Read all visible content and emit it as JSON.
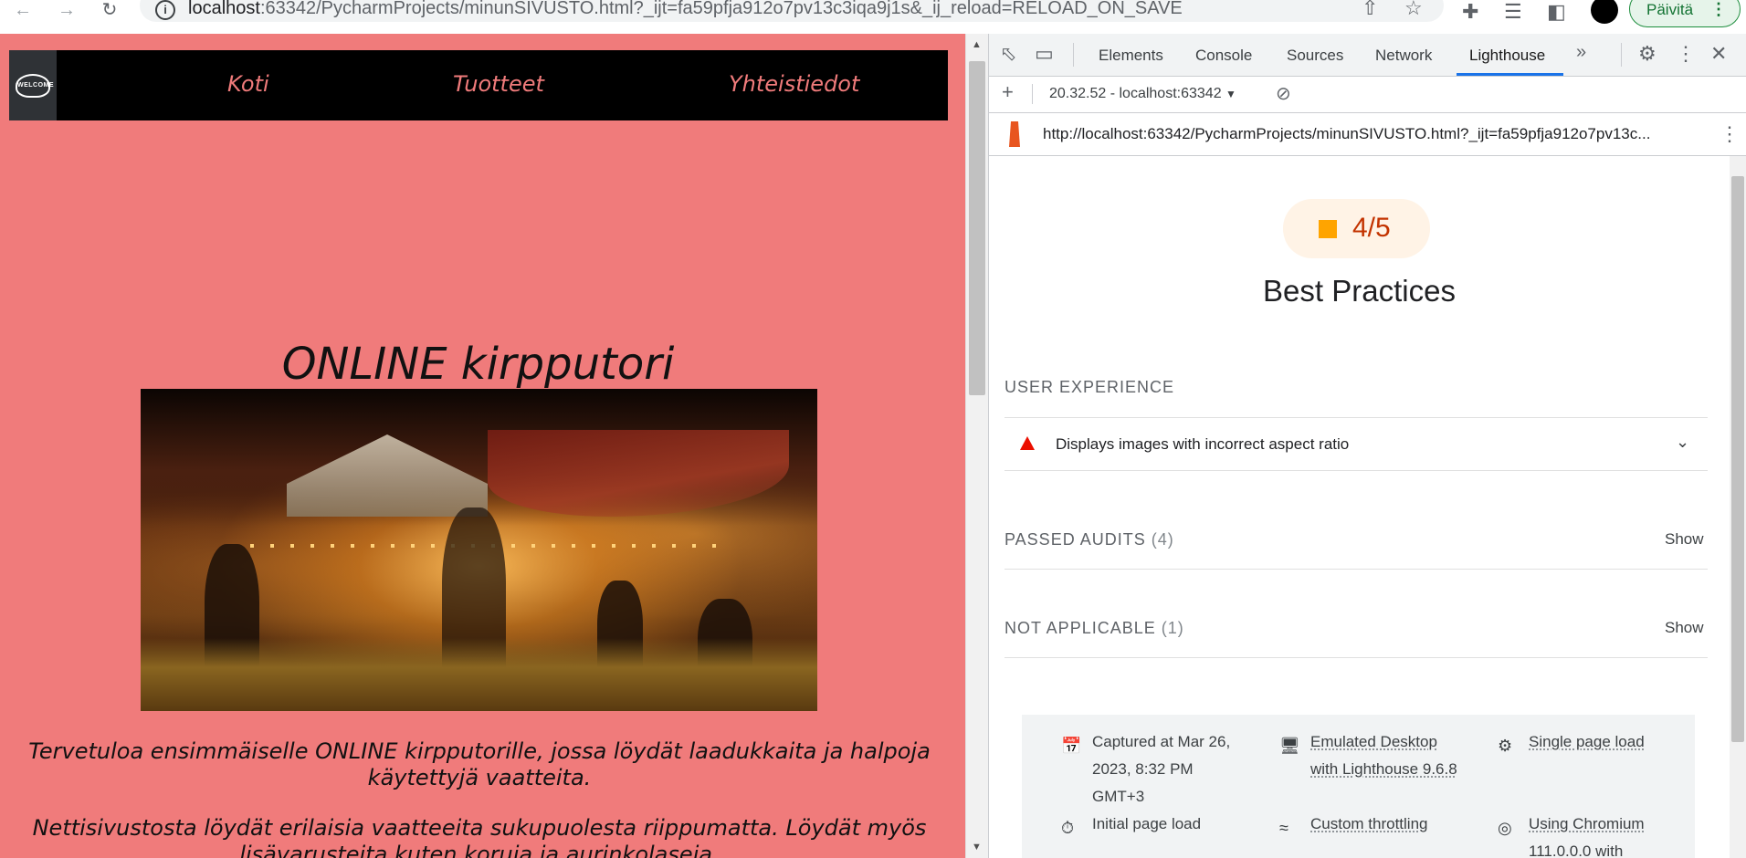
{
  "browser": {
    "url_host": "localhost",
    "url_rest": ":63342/PycharmProjects/minunSIVUSTO.html?_ijt=fa59pfja912o7pv13c3iqa9j1s&_ij_reload=RELOAD_ON_SAVE",
    "update_label": "Päivitä"
  },
  "site": {
    "logo_text": "WELCOME",
    "nav": [
      "Koti",
      "Tuotteet",
      "Yhteistiedot"
    ],
    "title": "ONLINE kirpputori",
    "paragraphs": [
      "Tervetuloa ensimmäiselle ONLINE kirpputorille, jossa löydät laadukkaita ja halpoja käytettyjä vaatteita.",
      "Nettisivustosta löydät erilaisia vaatteeita sukupuolesta riippumatta. Löydät myös lisävarusteita kuten koruja ja aurinkolaseja."
    ]
  },
  "devtools": {
    "tabs": [
      "Elements",
      "Console",
      "Sources",
      "Network",
      "Lighthouse"
    ],
    "active_tab": "Lighthouse",
    "report_selector": "20.32.52 - localhost:63342",
    "report_url": "http://localhost:63342/PycharmProjects/minunSIVUSTO.html?_ijt=fa59pfja912o7pv13c...",
    "score": "4/5",
    "score_color": "#ffa400",
    "category_title": "Best Practices",
    "sections": {
      "user_experience": "USER EXPERIENCE",
      "audit_fail": "Displays images with incorrect aspect ratio",
      "passed_label": "PASSED AUDITS",
      "passed_count": "(4)",
      "na_label": "NOT APPLICABLE",
      "na_count": "(1)",
      "show_label": "Show"
    },
    "footer": {
      "captured": "Captured at Mar 26, 2023, 8:32 PM GMT+3",
      "initial_load": "Initial page load",
      "emulated": "Emulated Desktop with Lighthouse 9.6.8",
      "throttling": "Custom throttling",
      "single_load": "Single page load",
      "chromium": "Using Chromium 111.0.0.0 with"
    }
  }
}
